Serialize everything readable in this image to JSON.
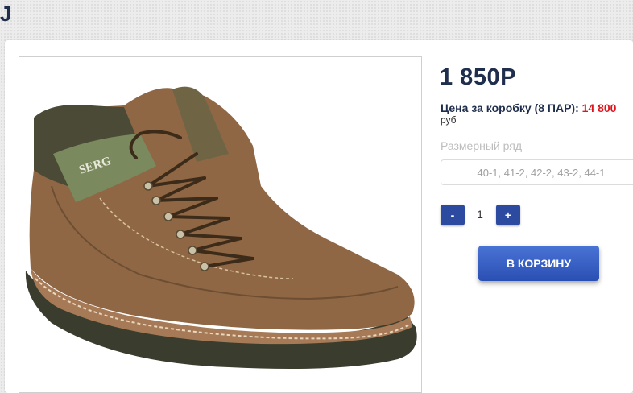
{
  "page": {
    "heading": "J"
  },
  "product": {
    "image_alt": "boot-photo",
    "brand_tag": "SERG",
    "price": "1 850Р",
    "box_price_label": "Цена за коробку (8 ПАР):",
    "box_price_value": "14 800",
    "currency": "руб",
    "size_label": "Размерный ряд",
    "size_range": "40-1, 41-2, 42-2, 43-2, 44-1"
  },
  "quantity": {
    "minus": "-",
    "value": "1",
    "plus": "+"
  },
  "cart": {
    "button_label": "В КОРЗИНУ"
  }
}
